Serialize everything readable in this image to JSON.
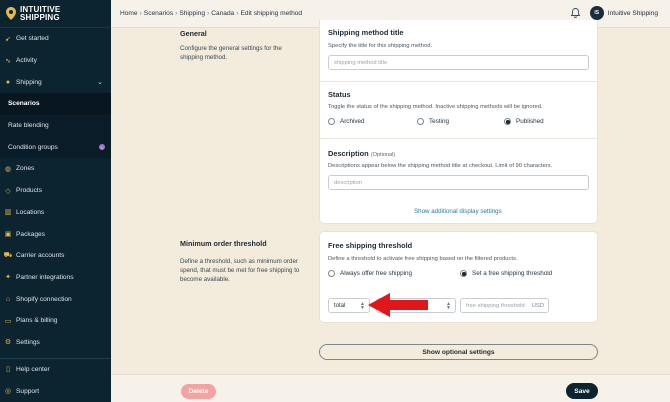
{
  "brand": {
    "line1": "INTUITIVE",
    "line2": "SHIPPING"
  },
  "sidebar": {
    "items": [
      {
        "label": "Get started",
        "icon": "rocket-icon"
      },
      {
        "label": "Activity",
        "icon": "pulse-icon"
      },
      {
        "label": "Shipping",
        "icon": "pin-icon"
      },
      {
        "label": "Scenarios"
      },
      {
        "label": "Rate blending"
      },
      {
        "label": "Condition groups",
        "badge": "i"
      },
      {
        "label": "Zones",
        "icon": "globe-icon"
      },
      {
        "label": "Products",
        "icon": "tag-icon"
      },
      {
        "label": "Locations",
        "icon": "building-icon"
      },
      {
        "label": "Packages",
        "icon": "box-icon"
      },
      {
        "label": "Carrier accounts",
        "icon": "truck-icon"
      },
      {
        "label": "Partner integrations",
        "icon": "handshake-icon"
      },
      {
        "label": "Shopify connection",
        "icon": "shop-icon"
      },
      {
        "label": "Plans & billing",
        "icon": "card-icon"
      },
      {
        "label": "Settings",
        "icon": "gear-icon"
      }
    ],
    "footer": [
      {
        "label": "Help center",
        "icon": "help-icon"
      },
      {
        "label": "Support",
        "icon": "support-icon"
      }
    ]
  },
  "breadcrumb": [
    "Home",
    "Scenarios",
    "Shipping",
    "Canada",
    "Edit shipping method"
  ],
  "user": {
    "initials": "IS",
    "name": "Intuitive Shipping"
  },
  "general": {
    "title": "General",
    "desc": "Configure the general settings for the shipping method."
  },
  "method_title": {
    "title": "Shipping method title",
    "help": "Specify the title for this shipping method.",
    "placeholder": "shipping method title"
  },
  "status": {
    "title": "Status",
    "help": "Toggle the status of the shipping method. Inactive shipping methods will be ignored.",
    "options": [
      "Archived",
      "Testing",
      "Published"
    ],
    "selected": "Published"
  },
  "description": {
    "title": "Description",
    "optional": "(Optional)",
    "help": "Descriptions appear below the shipping method title at checkout. Limit of 90 characters.",
    "placeholder": "description",
    "link": "Show additional display settings"
  },
  "min_order": {
    "title": "Minimum order threshold",
    "desc": "Define a threshold, such as minimum order spend, that must be met for free shipping to become available."
  },
  "free_shipping": {
    "title": "Free shipping threshold",
    "help": "Define a threshold to activate free shipping based on the filtered products.",
    "options": [
      "Always offer free shipping",
      "Set a free shipping threshold"
    ],
    "selected": "Set a free shipping threshold",
    "select_value": "total",
    "placeholder": "free shipping threshold",
    "unit": "USD"
  },
  "optional_button": "Show optional settings",
  "actions": {
    "delete": "Delete",
    "save": "Save"
  },
  "colors": {
    "sidebar": "#0c2330",
    "accent": "#e7b84a",
    "delete": "#f4a4a0",
    "arrow": "#e0161b",
    "link": "#2c79a4"
  }
}
